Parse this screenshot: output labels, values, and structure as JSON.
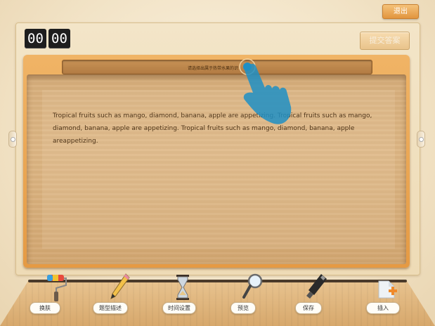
{
  "header": {
    "exit_label": "退出",
    "submit_label": "提交答案"
  },
  "timer": {
    "minutes": "00",
    "seconds": "00"
  },
  "question": {
    "prompt": "请选择出属于热带水果的识"
  },
  "passage": {
    "text": "Tropical fruits such as mango, diamond, banana, apple are appetizing. Tropical fruits such as mango, diamond, banana, apple are appetizing. Tropical fruits such as mango, diamond, banana, apple areappetizing."
  },
  "toolbar": {
    "items": [
      {
        "label": "换肤",
        "icon": "paint-roller-icon"
      },
      {
        "label": "题型描述",
        "icon": "pencil-icon"
      },
      {
        "label": "时间设置",
        "icon": "hourglass-icon"
      },
      {
        "label": "预览",
        "icon": "magnifier-icon"
      },
      {
        "label": "保存",
        "icon": "usb-drive-icon"
      },
      {
        "label": "插入",
        "icon": "insert-plus-icon"
      }
    ]
  },
  "colors": {
    "accent": "#e89a3e",
    "board": "#e59a43",
    "hand": "#1f8fc4"
  }
}
